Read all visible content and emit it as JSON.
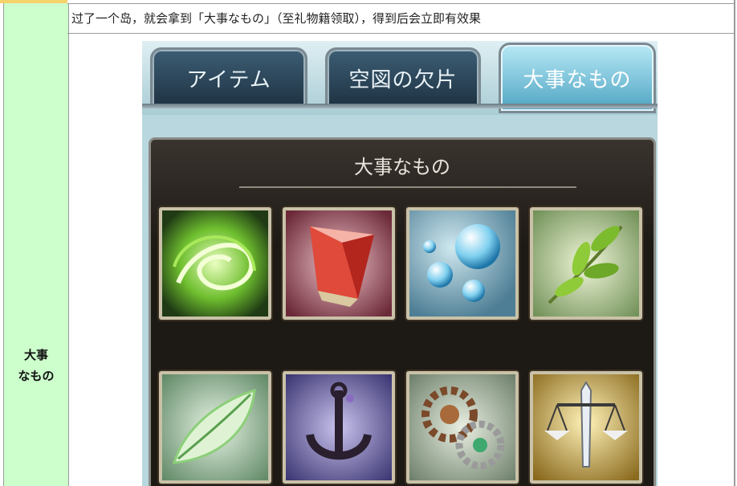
{
  "row": {
    "label_line1": "大事",
    "label_line2": "なもの",
    "description": "过了一个岛，就会拿到「大事なもの」（至礼物籍领取），得到后会立即有效果"
  },
  "game": {
    "tabs": [
      {
        "label": "アイテム",
        "active": false
      },
      {
        "label": "空図の欠片",
        "active": false
      },
      {
        "label": "大事なもの",
        "active": true
      }
    ],
    "section_title": "大事なもの",
    "items": [
      {
        "icon": "green-swirl-icon"
      },
      {
        "icon": "red-crystal-icon"
      },
      {
        "icon": "water-bubbles-icon"
      },
      {
        "icon": "green-leaf-branch-icon"
      },
      {
        "icon": "pale-leaf-icon"
      },
      {
        "icon": "dark-anchor-icon"
      },
      {
        "icon": "gears-icon"
      },
      {
        "icon": "sword-scales-icon"
      }
    ]
  },
  "colors": {
    "label_cell_bg": "#ccffcc",
    "tab_active": "#4fa4c3",
    "tab_inactive": "#1f3343"
  }
}
